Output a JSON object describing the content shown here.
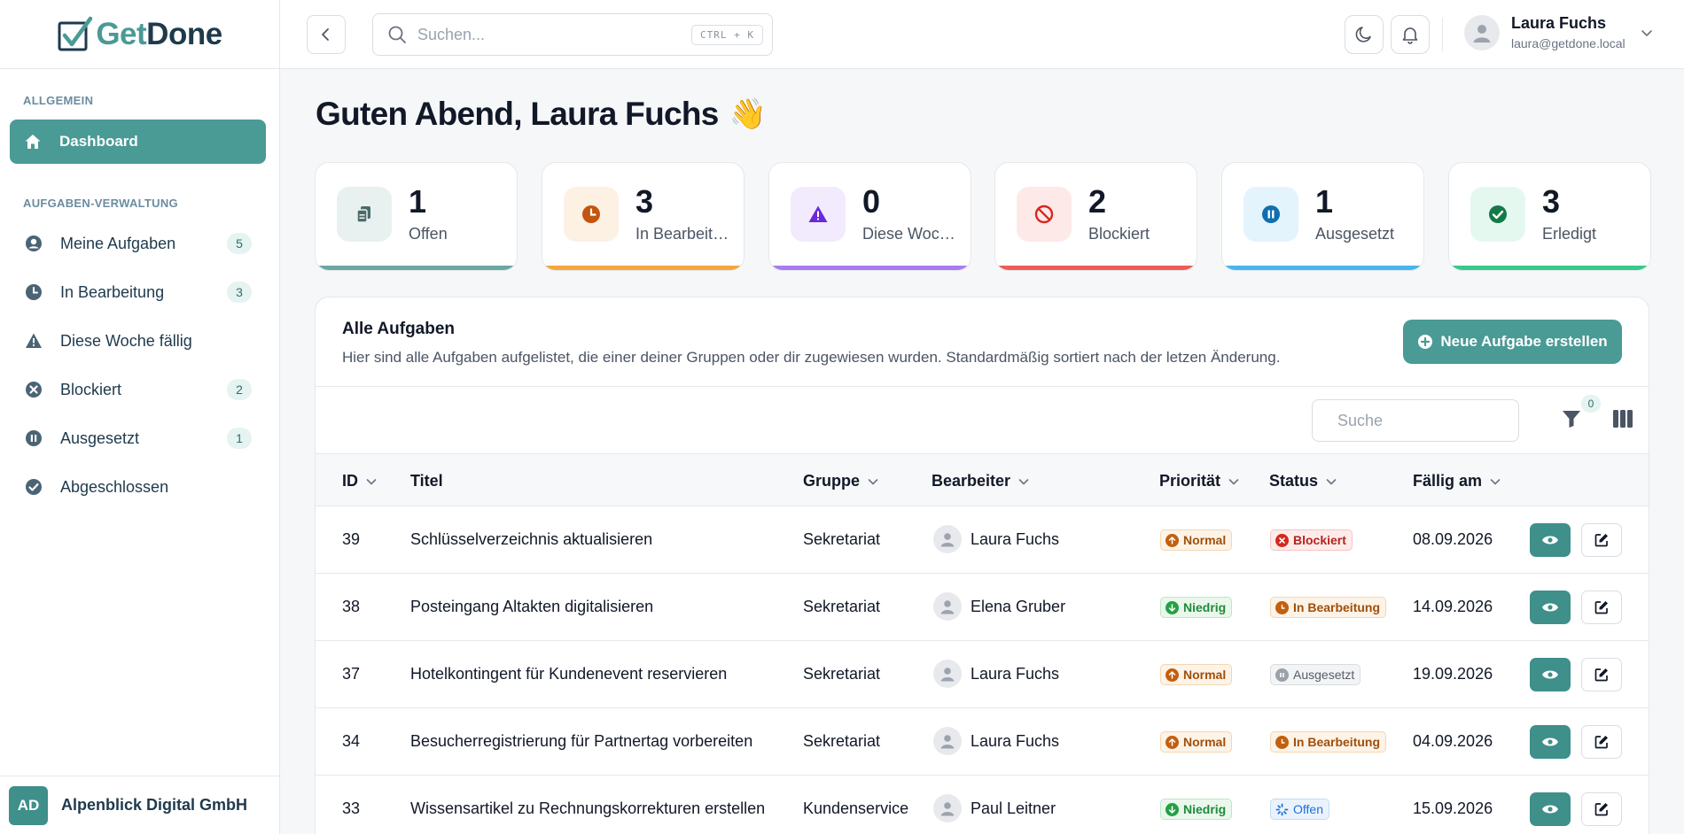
{
  "app": {
    "logo_get": "Get",
    "logo_done": "Done"
  },
  "topbar": {
    "search_placeholder": "Suchen...",
    "shortcut": "CTRL + K",
    "user_name": "Laura Fuchs",
    "user_email": "laura@getdone.local"
  },
  "sidebar": {
    "section_general": "ALLGEMEIN",
    "dashboard": "Dashboard",
    "section_tasks": "AUFGABEN-VERWALTUNG",
    "items": [
      {
        "label": "Meine Aufgaben",
        "badge": "5",
        "icon": "user-circle-icon"
      },
      {
        "label": "In Bearbeitung",
        "badge": "3",
        "icon": "clock-icon"
      },
      {
        "label": "Diese Woche fällig",
        "badge": "",
        "icon": "warning-icon"
      },
      {
        "label": "Blockiert",
        "badge": "2",
        "icon": "x-circle-icon"
      },
      {
        "label": "Ausgesetzt",
        "badge": "1",
        "icon": "pause-circle-icon"
      },
      {
        "label": "Abgeschlossen",
        "badge": "",
        "icon": "check-circle-icon"
      }
    ],
    "org_initials": "AD",
    "org_name": "Alpenblick Digital GmbH"
  },
  "greeting": "Guten Abend, Laura Fuchs",
  "greeting_emoji": "👋",
  "stats": [
    {
      "value": "1",
      "label": "Offen",
      "color": "#6aa8a4",
      "bg": "#e8f1f0",
      "icon": "clipboard-icon"
    },
    {
      "value": "3",
      "label": "In Bearbeitung",
      "color": "#f3a73c",
      "bg": "#fdf1e4",
      "icon": "clock-icon"
    },
    {
      "value": "0",
      "label": "Diese Woche fällig",
      "color": "#a77cf0",
      "bg": "#f1ebfd",
      "icon": "warning-icon"
    },
    {
      "value": "2",
      "label": "Blockiert",
      "color": "#ef5b57",
      "bg": "#fde9e8",
      "icon": "ban-icon"
    },
    {
      "value": "1",
      "label": "Ausgesetzt",
      "color": "#48b5f0",
      "bg": "#e4f4fd",
      "icon": "pause-circle-icon"
    },
    {
      "value": "3",
      "label": "Erledigt",
      "color": "#38c98b",
      "bg": "#e5f8ef",
      "icon": "check-circle-icon"
    }
  ],
  "tasks": {
    "title": "Alle Aufgaben",
    "description": "Hier sind alle Aufgaben aufgelistet, die einer deiner Gruppen oder dir zugewiesen wurden. Standardmäßig sortiert nach der letzen Änderung.",
    "new_button": "Neue Aufgabe erstellen",
    "search_placeholder": "Suche",
    "filter_count": "0",
    "columns": [
      "ID",
      "Titel",
      "Gruppe",
      "Bearbeiter",
      "Priorität",
      "Status",
      "Fällig am"
    ],
    "rows": [
      {
        "id": "39",
        "title": "Schlüsselverzeichnis aktualisieren",
        "group": "Sekretariat",
        "assignee": "Laura Fuchs",
        "priority": "Normal",
        "status": "Blockiert",
        "due": "08.09.2026"
      },
      {
        "id": "38",
        "title": "Posteingang Altakten digitalisieren",
        "group": "Sekretariat",
        "assignee": "Elena Gruber",
        "priority": "Niedrig",
        "status": "In Bearbeitung",
        "due": "14.09.2026"
      },
      {
        "id": "37",
        "title": "Hotelkontingent für Kundenevent reservieren",
        "group": "Sekretariat",
        "assignee": "Laura Fuchs",
        "priority": "Normal",
        "status": "Ausgesetzt",
        "due": "19.09.2026"
      },
      {
        "id": "34",
        "title": "Besucherregistrierung für Partnertag vorbereiten",
        "group": "Sekretariat",
        "assignee": "Laura Fuchs",
        "priority": "Normal",
        "status": "In Bearbeitung",
        "due": "04.09.2026"
      },
      {
        "id": "33",
        "title": "Wissensartikel zu Rechnungskorrekturen erstellen",
        "group": "Kundenservice",
        "assignee": "Paul Leitner",
        "priority": "Niedrig",
        "status": "Offen",
        "due": "15.09.2026"
      }
    ]
  }
}
